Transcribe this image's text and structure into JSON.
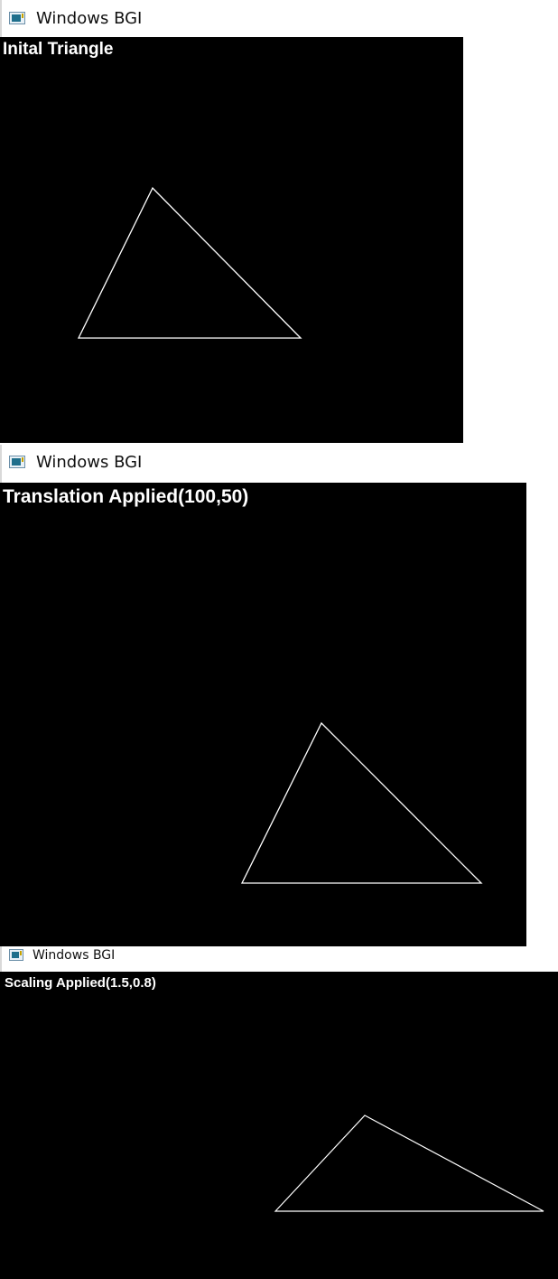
{
  "windows": [
    {
      "title": "Windows BGI",
      "label": "Inital Triangle"
    },
    {
      "title": "Windows BGI",
      "label": "Translation Applied(100,50)"
    },
    {
      "title": "Windows BGI",
      "label": "Scaling Applied(1.5,0.8)"
    }
  ],
  "colors": {
    "canvas": "#000000",
    "stroke": "#ffffff",
    "text": "#ffffff"
  },
  "icons": {
    "window_icon": "bgi-window-icon"
  }
}
